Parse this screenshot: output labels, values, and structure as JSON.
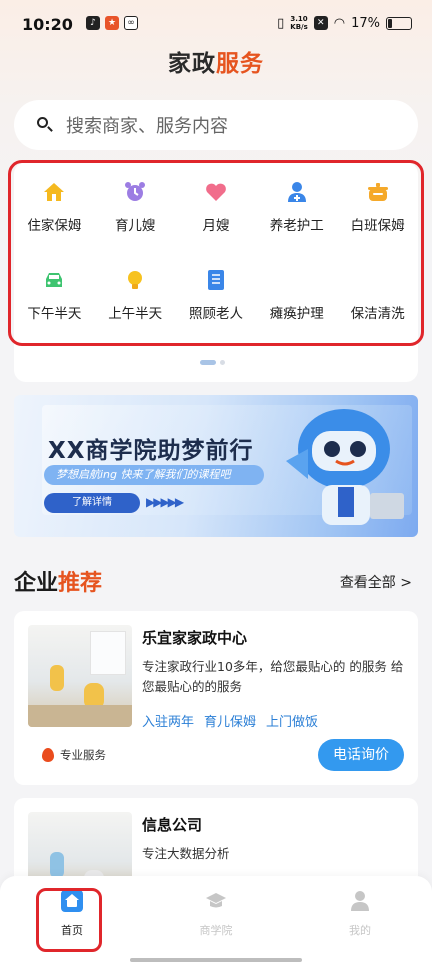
{
  "status_bar": {
    "time": "10:20",
    "net_speed_value": "3.10",
    "net_speed_unit": "KB/s",
    "battery": "17%"
  },
  "header": {
    "title_part1": "家政",
    "title_part2": "服务"
  },
  "search": {
    "placeholder": "搜索商家、服务内容"
  },
  "categories": [
    {
      "label": "住家保姆",
      "icon": "house-icon",
      "color": "#f5b91f"
    },
    {
      "label": "育儿嫂",
      "icon": "alarm-clock-icon",
      "color": "#9c7de3"
    },
    {
      "label": "月嫂",
      "icon": "heart-icon",
      "color": "#f16d8b"
    },
    {
      "label": "养老护工",
      "icon": "caregiver-icon",
      "color": "#3a86e8"
    },
    {
      "label": "白班保姆",
      "icon": "pot-icon",
      "color": "#f5a92a"
    },
    {
      "label": "下午半天",
      "icon": "car-icon",
      "color": "#3ec470"
    },
    {
      "label": "上午半天",
      "icon": "bulb-icon",
      "color": "#f7c21f"
    },
    {
      "label": "照顾老人",
      "icon": "book-icon",
      "color": "#3a86e8"
    },
    {
      "label": "瘫痪护理",
      "icon": "blank-icon",
      "color": "#ffffff"
    },
    {
      "label": "保洁清洗",
      "icon": "blank-icon",
      "color": "#ffffff"
    }
  ],
  "banner": {
    "title": "XX商学院助梦前行",
    "subtitle": "梦想启航ing 快来了解我们的课程吧",
    "button": "了解详情",
    "arrows": "▶▶▶▶▶"
  },
  "section": {
    "title_part1": "企业",
    "title_part2": "推荐",
    "more": "查看全部 >"
  },
  "companies": [
    {
      "name": "乐宜家家政中心",
      "desc": "专注家政行业10多年，给您最贴心的 的服务 给您最贴心的的服务",
      "tags": [
        "入驻两年",
        "育儿保姆",
        "上门做饭"
      ],
      "badge": "专业服务",
      "action": "电话询价"
    },
    {
      "name": "信息公司",
      "desc": "专注大数据分析"
    }
  ],
  "tabbar": [
    {
      "label": "首页",
      "icon": "home-icon",
      "active": true
    },
    {
      "label": "商学院",
      "icon": "graduation-cap-icon",
      "active": false
    },
    {
      "label": "我的",
      "icon": "user-icon",
      "active": false
    }
  ],
  "colors": {
    "accent": "#e6541f",
    "primary_blue": "#3399ef",
    "highlight_red": "#e0262b"
  }
}
